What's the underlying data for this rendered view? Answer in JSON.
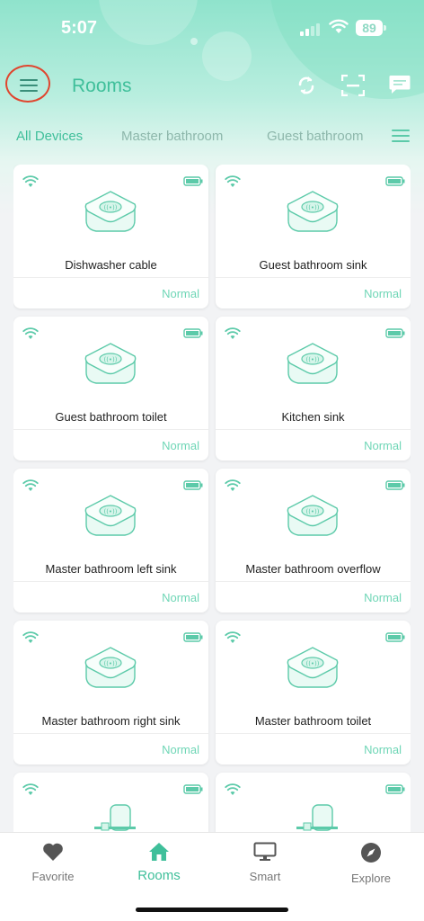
{
  "status_bar": {
    "time": "5:07",
    "battery_level": "89"
  },
  "header": {
    "title": "Rooms",
    "icons": [
      "menu-icon",
      "sync-icon",
      "scan-icon",
      "message-icon"
    ]
  },
  "tabs": {
    "items": [
      {
        "label": "All Devices",
        "active": true
      },
      {
        "label": "Master bathroom",
        "active": false
      },
      {
        "label": "Guest bathroom",
        "active": false
      }
    ]
  },
  "devices": [
    {
      "name": "Dishwasher cable",
      "status": "Normal"
    },
    {
      "name": "Guest bathroom sink",
      "status": "Normal"
    },
    {
      "name": "Guest bathroom toilet",
      "status": "Normal"
    },
    {
      "name": "Kitchen sink",
      "status": "Normal"
    },
    {
      "name": "Master bathroom left sink",
      "status": "Normal"
    },
    {
      "name": "Master bathroom overflow",
      "status": "Normal"
    },
    {
      "name": "Master bathroom right sink",
      "status": "Normal"
    },
    {
      "name": "Master bathroom toilet",
      "status": "Normal"
    },
    {
      "name": "",
      "status": ""
    },
    {
      "name": "",
      "status": ""
    }
  ],
  "bottom_nav": {
    "items": [
      {
        "label": "Favorite",
        "icon": "heart-icon",
        "active": false
      },
      {
        "label": "Rooms",
        "icon": "home-icon",
        "active": true
      },
      {
        "label": "Smart",
        "icon": "monitor-icon",
        "active": false
      },
      {
        "label": "Explore",
        "icon": "compass-icon",
        "active": false
      }
    ]
  },
  "colors": {
    "accent": "#3fbf9a",
    "status_normal": "#6fd6b6",
    "highlight_ring": "#e0452e"
  }
}
